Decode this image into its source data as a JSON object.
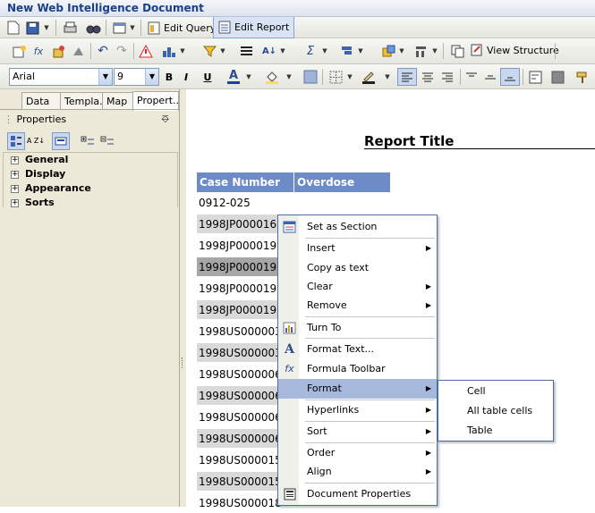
{
  "window": {
    "title": "New Web Intelligence Document"
  },
  "toolbar": {
    "edit_query_label": "Edit Query",
    "edit_report_label": "Edit Report",
    "view_structure_label": "View Structure"
  },
  "format_bar": {
    "font_name": "Arial",
    "font_size": "9",
    "bold": "B",
    "italic": "I",
    "underline": "U",
    "font_color_glyph": "A"
  },
  "left_panel": {
    "tabs": [
      "Data",
      "Templa...",
      "Map",
      "Propert..."
    ],
    "active_tab": "Propert...",
    "header": "Properties",
    "pin": "⎑",
    "sort_label": "A Z",
    "properties": [
      "General",
      "Display",
      "Appearance",
      "Sorts"
    ]
  },
  "report": {
    "title": "Report Title",
    "columns": [
      "Case Number",
      "Overdose"
    ],
    "rows": [
      {
        "case": "0912-025",
        "shaded": false
      },
      {
        "case": "1998JP000016",
        "shaded": true
      },
      {
        "case": "1998JP000019",
        "shaded": false
      },
      {
        "case": "1998JP000019",
        "shaded": true
      },
      {
        "case": "1998JP000019",
        "shaded": false
      },
      {
        "case": "1998JP000019",
        "shaded": true
      },
      {
        "case": "1998US000003",
        "shaded": false
      },
      {
        "case": "1998US000003",
        "shaded": true
      },
      {
        "case": "1998US000006",
        "shaded": false
      },
      {
        "case": "1998US000006",
        "shaded": true
      },
      {
        "case": "1998US000006",
        "shaded": false
      },
      {
        "case": "1998US000006",
        "shaded": true
      },
      {
        "case": "1998US000015",
        "shaded": false
      },
      {
        "case": "1998US000015",
        "shaded": true
      },
      {
        "case": "1998US000018",
        "shaded": false
      }
    ]
  },
  "context_menu": {
    "items": [
      {
        "label": "Set as Section",
        "icon": "section-icon",
        "submenu": false
      },
      {
        "label": "Insert",
        "submenu": true
      },
      {
        "label": "Copy as text",
        "submenu": false
      },
      {
        "label": "Clear",
        "submenu": true
      },
      {
        "label": "Remove",
        "submenu": true
      },
      {
        "label": "Turn To",
        "icon": "chart-icon",
        "submenu": false
      },
      {
        "label": "Format Text...",
        "icon": "text-format-icon",
        "submenu": false
      },
      {
        "label": "Formula Toolbar",
        "icon": "formula-icon",
        "submenu": false
      },
      {
        "label": "Format",
        "submenu": true,
        "highlighted": true
      },
      {
        "label": "Hyperlinks",
        "submenu": true
      },
      {
        "label": "Sort",
        "submenu": true
      },
      {
        "label": "Order",
        "submenu": true
      },
      {
        "label": "Align",
        "submenu": true
      },
      {
        "label": "Document Properties",
        "icon": "document-properties-icon",
        "submenu": false
      }
    ],
    "submenu": [
      "Cell",
      "All table cells",
      "Table"
    ]
  },
  "colors": {
    "header_blue": "#6d8bc7",
    "row_shaded": "#d9d9d9",
    "row_dark": "#a6a6a6",
    "menu_highlight": "#a6b9dd"
  }
}
